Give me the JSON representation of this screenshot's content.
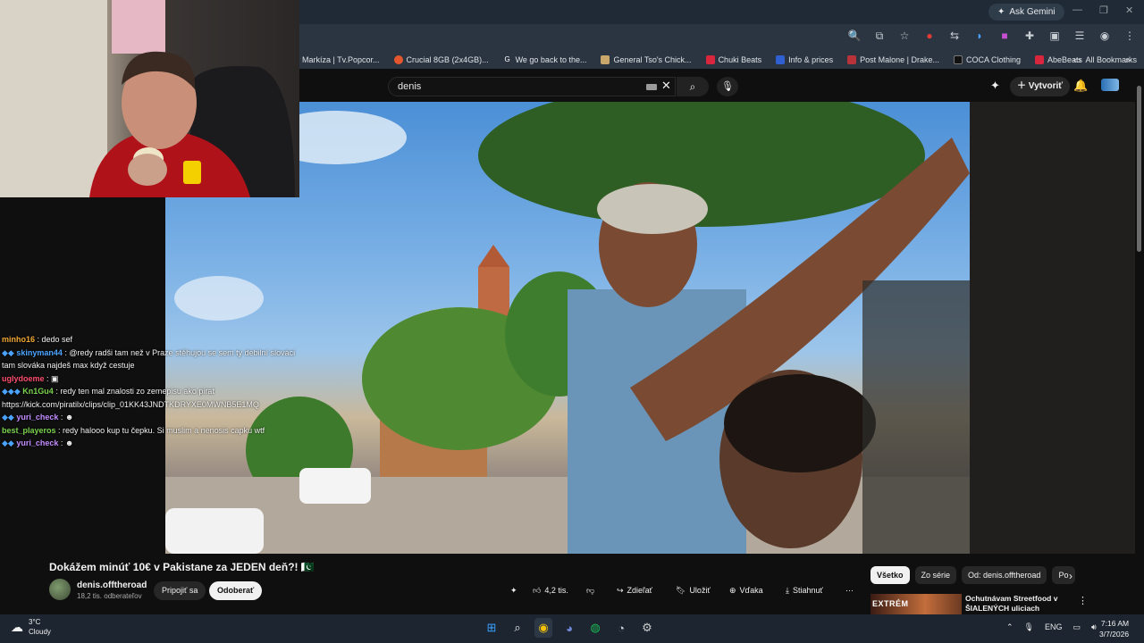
{
  "browser": {
    "ask_gemini": "Ask Gemini",
    "bookmarks": [
      {
        "label": "Markíza | Tv.Popcor...",
        "color": "#e8e8e8"
      },
      {
        "label": "Crucial 8GB (2x4GB)...",
        "color": "#e4572e"
      },
      {
        "label": "We go back to the...",
        "color": "#9aa0a6"
      },
      {
        "label": "General Tso's Chick...",
        "color": "#c9a76a"
      },
      {
        "label": "Chuki Beats",
        "color": "#d7263d"
      },
      {
        "label": "Info & prices",
        "color": "#2f5fd0"
      },
      {
        "label": "Post Malone | Drake...",
        "color": "#b8323a"
      },
      {
        "label": "COCA Clothing",
        "color": "#222222"
      },
      {
        "label": "AbeBeats",
        "color": "#d7263d"
      }
    ],
    "all_bookmarks": "All Bookmarks"
  },
  "youtube": {
    "search_value": "denis",
    "create_label": "Vytvoriť",
    "video_title": "Dokážem minúť 10€ v Pakistane za JEDEN deň?! 🇵🇰",
    "channel": {
      "name": "denis.offtheroad",
      "subs": "18,2 tis. odberateľov",
      "join_label": "Pripojiť sa",
      "unsubscribe_label": "Odoberať"
    },
    "actions": {
      "likes": "4,2 tis.",
      "share": "Zdieľať",
      "save": "Uložiť",
      "thanks": "Vďaka",
      "download": "Stiahnuť"
    },
    "chips": [
      "Všetko",
      "Zo série",
      "Od: denis.offtheroad",
      "Po"
    ],
    "recommended": {
      "badge": "EXTRÉM",
      "title": "Ochutnávam Streetfood v ŠIALENÝCH uliciach Pakistan..."
    }
  },
  "chat": [
    {
      "user": "minho16",
      "color": "#f0a830",
      "text": ": dedo sef"
    },
    {
      "user": "skinyman44",
      "color": "#4aa3ff",
      "text": ": @redy radši tam než v Praze stěhujou se sem ty debilní slováci tam slováka najdeš max když cestuje"
    },
    {
      "user": "uglydoeme",
      "color": "#ff4d6d",
      "text": ": "
    },
    {
      "user": "Kn1Gu4",
      "color": "#7bd34f",
      "text": ": redy ten mal znalosti zo zemepisu ako pirat https://kick.com/piratilx/clips/clip_01KK43JNDTKDRYXE0MWNB5E1MQ"
    },
    {
      "user": "yuri_check",
      "color": "#c28cff",
      "text": ": "
    },
    {
      "user": "best_playeros",
      "color": "#7bd34f",
      "text": ": redy halooo kup tu čepku. Si muslim a nenosis capku wtf"
    },
    {
      "user": "yuri_check",
      "color": "#c28cff",
      "text": ": "
    }
  ],
  "taskbar": {
    "temp": "3°C",
    "weather": "Cloudy",
    "lang": "ENG",
    "time": "7:16 AM",
    "date": "3/7/2026"
  }
}
